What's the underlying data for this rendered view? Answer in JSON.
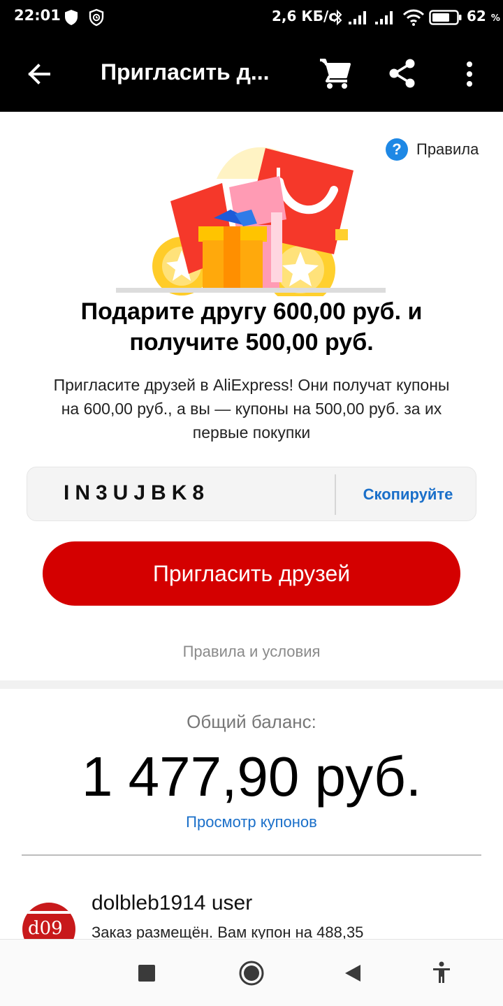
{
  "status_bar": {
    "time": "22:01",
    "speed": "2,6 КБ/с",
    "battery_number": "62",
    "battery_unit": "%",
    "icons": [
      "shield-icon",
      "shield-clock-icon",
      "bluetooth-icon",
      "signal-icon",
      "signal-icon",
      "wifi-icon",
      "battery-icon"
    ]
  },
  "app_bar": {
    "title": "Пригласить д...",
    "icons": [
      "back-arrow-icon",
      "cart-icon",
      "share-icon",
      "more-vert-icon"
    ]
  },
  "rules_link": "Правила",
  "headline": {
    "line1": "Подарите другу 600,00 руб. и",
    "line2": "получите 500,00 руб."
  },
  "description": {
    "line1": "Пригласите друзей в AliExpress! Они получат купоны",
    "line2": "на 600,00 руб., а вы — купоны на 500,00 руб. за их",
    "line3": "первые покупки"
  },
  "invite_code": {
    "code": "IN3UJBK8",
    "copy_label": "Скопируйте"
  },
  "invite_button": "Пригласить друзей",
  "terms_link": "Правила и условия",
  "balance": {
    "label": "Общий баланс:",
    "value": "1 477,90 руб.",
    "coupons_link": "Просмотр купонов"
  },
  "referral": {
    "avatar_text": "d09",
    "name": "dolbleb1914 user",
    "status": "Заказ размещён. Вам купон на 488,35"
  },
  "colors": {
    "accent_red": "#d40000",
    "link_blue": "#1a6fc9",
    "help_blue": "#1e88e5",
    "bar_black": "#000000"
  }
}
